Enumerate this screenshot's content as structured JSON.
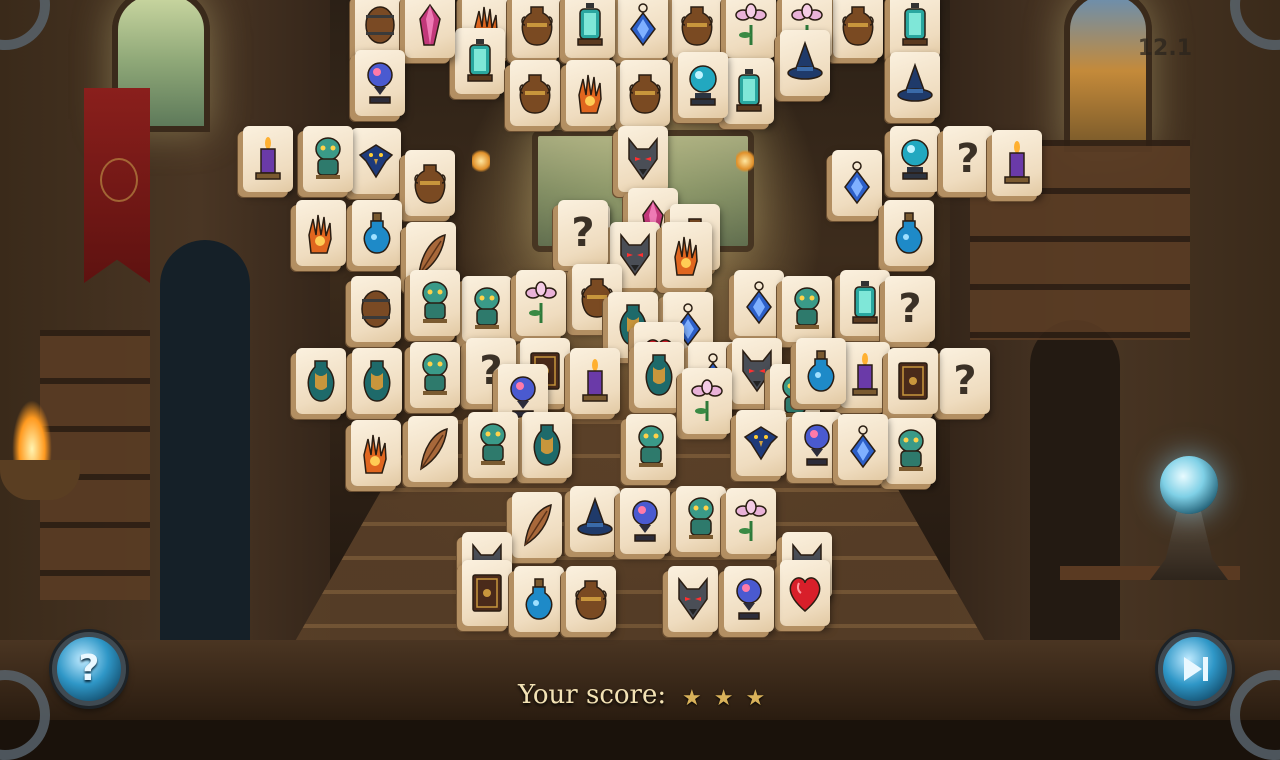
{
  "hud": {
    "score_label": "Your score:",
    "stars": [
      "★",
      "★",
      "★"
    ],
    "level": "12.1"
  },
  "buttons": {
    "hint_icon": "question-mark-icon",
    "skip_icon": "skip-forward-icon"
  },
  "colors": {
    "tile_face": "#f3e4c9",
    "tile_edge": "#b38f62",
    "button_blue": "#2f97c7",
    "score_text": "#f3e2b4",
    "star": "#d9b25a"
  },
  "tiles": [
    "barrel",
    "crystal",
    "flame-hand",
    "amphora",
    "lantern",
    "amulet",
    "amphora",
    "lily",
    "lily",
    "amphora",
    "lantern",
    "crystal-goblet",
    "lantern",
    "amphora",
    "flame-hand",
    "amphora",
    "crystal-ball",
    "lantern",
    "witch-hat",
    "witch-hat",
    "candle",
    "golem",
    "crow",
    "amphora",
    "question-mark",
    "crystal-ball",
    "question-mark",
    "candle",
    "wolf",
    "amulet",
    "crystal",
    "flame-hand",
    "potion-bottle",
    "feather",
    "question-mark",
    "wolf",
    "flame-hand",
    "amphora",
    "potion-bottle",
    "barrel",
    "golem",
    "golem",
    "lily",
    "amphora",
    "vase",
    "amulet",
    "amulet",
    "golem",
    "lantern",
    "question-mark",
    "vase",
    "vase",
    "golem",
    "question-mark",
    "spellbook",
    "candle",
    "vase",
    "amulet",
    "wolf",
    "potion-bottle",
    "candle",
    "spellbook",
    "question-mark",
    "crystal-goblet",
    "heart-gem",
    "lily",
    "golem",
    "flame-hand",
    "feather",
    "golem",
    "vase",
    "golem",
    "crow",
    "crystal-goblet",
    "amulet",
    "golem",
    "feather",
    "witch-hat",
    "crystal-goblet",
    "golem",
    "lily",
    "wolf",
    "wolf",
    "spellbook",
    "potion-bottle",
    "amphora",
    "wolf",
    "crystal-goblet",
    "heart-gem"
  ]
}
